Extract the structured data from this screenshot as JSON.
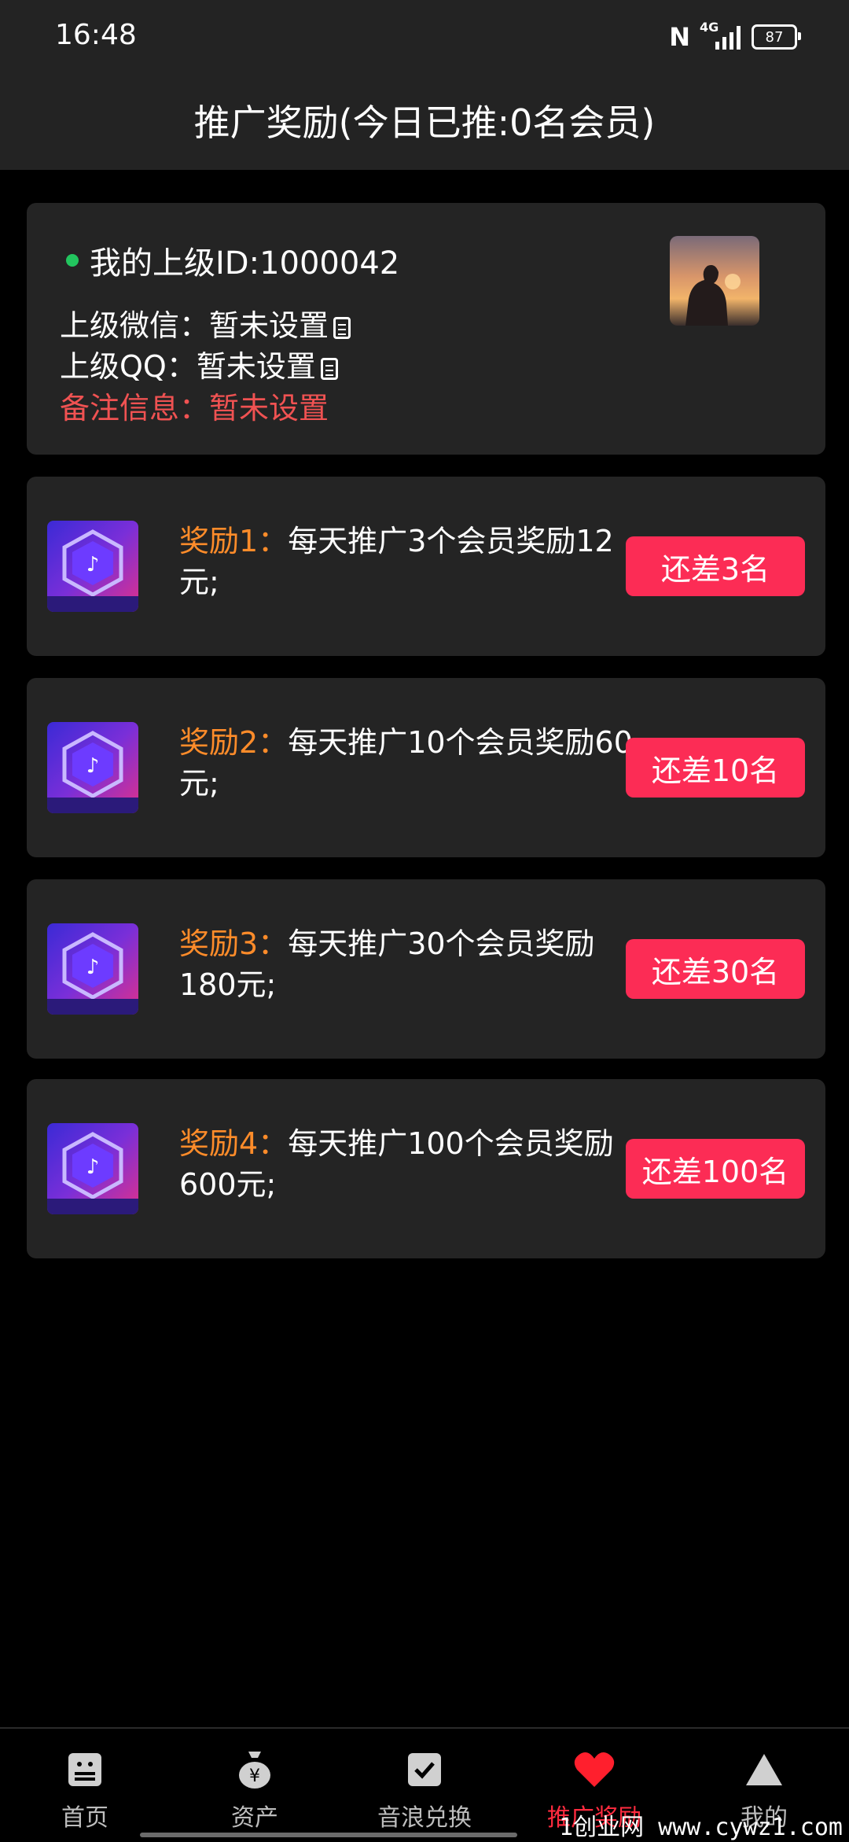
{
  "status_bar": {
    "time": "16:48",
    "network": "4G",
    "battery": "87"
  },
  "header": {
    "title": "推广奖励(今日已推:0名会员)"
  },
  "superior": {
    "id_text": "我的上级ID:1000042",
    "wechat": "上级微信：暂未设置",
    "qq": "上级QQ：暂未设置",
    "remark": "备注信息：暂未设置"
  },
  "rewards": [
    {
      "prefix": "奖励1：",
      "desc": "每天推广3个会员奖励12元;",
      "button": "还差3名"
    },
    {
      "prefix": "奖励2：",
      "desc": "每天推广10个会员奖励60元;",
      "button": "还差10名"
    },
    {
      "prefix": "奖励3：",
      "desc": "每天推广30个会员奖励180元;",
      "button": "还差30名"
    },
    {
      "prefix": "奖励4：",
      "desc": "每天推广100个会员奖励600元;",
      "button": "还差100名"
    }
  ],
  "tabs": [
    {
      "label": "首页",
      "icon": "home-icon"
    },
    {
      "label": "资产",
      "icon": "money-bag-icon"
    },
    {
      "label": "音浪兑换",
      "icon": "checkbox-icon"
    },
    {
      "label": "推广奖励",
      "icon": "heart-icon"
    },
    {
      "label": "我的",
      "icon": "triangle-icon"
    }
  ],
  "watermark": "1创业网 www.cywz1.com",
  "colors": {
    "accent_red": "#fc2c55",
    "prefix_orange": "#ff8c2a",
    "online_green": "#22c55e",
    "remark_red": "#f05252"
  }
}
